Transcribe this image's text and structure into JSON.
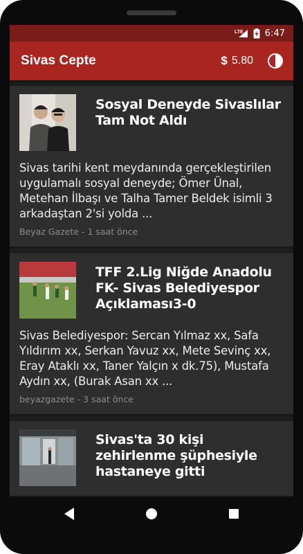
{
  "status_bar": {
    "network": "LTE",
    "time": "6:47"
  },
  "app_bar": {
    "title": "Sivas Cepte",
    "currency_icon": "dollar-icon",
    "price": "5.80",
    "theme_icon": "theme-toggle-icon"
  },
  "colors": {
    "status_bar": "#7a1d1a",
    "app_bar": "#a8261f",
    "background": "#1f1f1f",
    "card": "#2e2e2e"
  },
  "articles": [
    {
      "title": "Sosyal Deneyde Sivaslılar Tam Not Aldı",
      "summary": "Sivas tarihi kent meydanında gerçekleştirilen uygulamalı sosyal deneyde; Ömer Ünal, Metehan İlbaşı ve Talha Tamer Beldek isimli 3 arkadaştan 2'si yolda ...",
      "source": "Beyaz Gazete",
      "time": "1 saat önce",
      "meta": "Beyaz Gazete - 1 saat önce"
    },
    {
      "title": "TFF 2.Lig Niğde Anadolu FK- Sivas Belediyespor Açıklaması3-0",
      "summary": "Sivas Belediyespor: Sercan Yılmaz xx, Safa Yıldırım xx, Serkan Yavuz xx, Mete Sevinç xx, Eray Ataklı xx, Taner Yalçın x dk.75), Mustafa Aydın xx, (Burak Asan xx ...",
      "source": "beyazgazete",
      "time": "3 saat önce",
      "meta": "beyazgazete - 3 saat önce"
    },
    {
      "title": "Sivas'ta 30 kişi zehirlenme şüphesiyle hastaneye gitti",
      "summary": "",
      "source": "",
      "time": "",
      "meta": ""
    }
  ],
  "nav_bar": {
    "back_icon": "back-icon",
    "home_icon": "home-icon",
    "recents_icon": "recents-icon"
  }
}
